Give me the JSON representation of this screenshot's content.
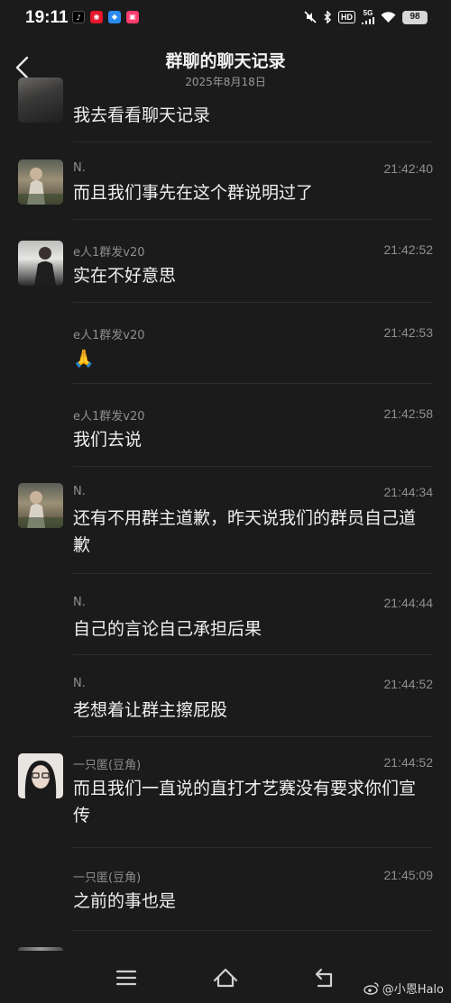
{
  "status_bar": {
    "time": "19:11",
    "battery": "98",
    "network": "5G",
    "hd": "HD",
    "app_icons": [
      "tiktok-icon",
      "weibo-icon",
      "app-icon",
      "app-icon"
    ]
  },
  "header": {
    "title": "群聊的聊天记录",
    "subtitle": "2025年8月18日",
    "back_icon": "chevron-left-icon"
  },
  "messages": [
    {
      "sender": "",
      "time": "",
      "text": "我去看看聊天记录",
      "avatar": "photo-avatar",
      "show_avatar": true
    },
    {
      "sender": "N.",
      "time": "21:42:40",
      "text": "而且我们事先在这个群说明过了",
      "avatar": "photo-avatar",
      "show_avatar": true
    },
    {
      "sender": "e人1群发v20",
      "time": "21:42:52",
      "text": "实在不好意思",
      "avatar": "photo-avatar",
      "show_avatar": true
    },
    {
      "sender": "e人1群发v20",
      "time": "21:42:53",
      "text": "🙏",
      "avatar": "",
      "show_avatar": false
    },
    {
      "sender": "e人1群发v20",
      "time": "21:42:58",
      "text": "我们去说",
      "avatar": "",
      "show_avatar": false
    },
    {
      "sender": "N.",
      "time": "21:44:34",
      "text": "还有不用群主道歉，昨天说我们的群员自己道歉",
      "avatar": "photo-avatar",
      "show_avatar": true
    },
    {
      "sender": "N.",
      "time": "21:44:44",
      "text": "自己的言论自己承担后果",
      "avatar": "",
      "show_avatar": false
    },
    {
      "sender": "N.",
      "time": "21:44:52",
      "text": "老想着让群主擦屁股",
      "avatar": "",
      "show_avatar": false
    },
    {
      "sender": "一只匿(豆角)",
      "time": "21:44:52",
      "text": "而且我们一直说的直打才艺赛没有要求你们宣传",
      "avatar": "photo-avatar",
      "show_avatar": true
    },
    {
      "sender": "一只匿(豆角)",
      "time": "21:45:09",
      "text": "之前的事也是",
      "avatar": "",
      "show_avatar": false
    }
  ],
  "nav": {
    "menu_icon": "menu-icon",
    "home_icon": "home-icon",
    "back_icon": "return-icon"
  },
  "watermark": {
    "text": "@小恩Halo",
    "icon": "weibo-icon"
  },
  "colors": {
    "background": "#1b1b1b",
    "text": "#efefef",
    "muted": "#8e8e8e",
    "divider": "#2d2d2d"
  }
}
